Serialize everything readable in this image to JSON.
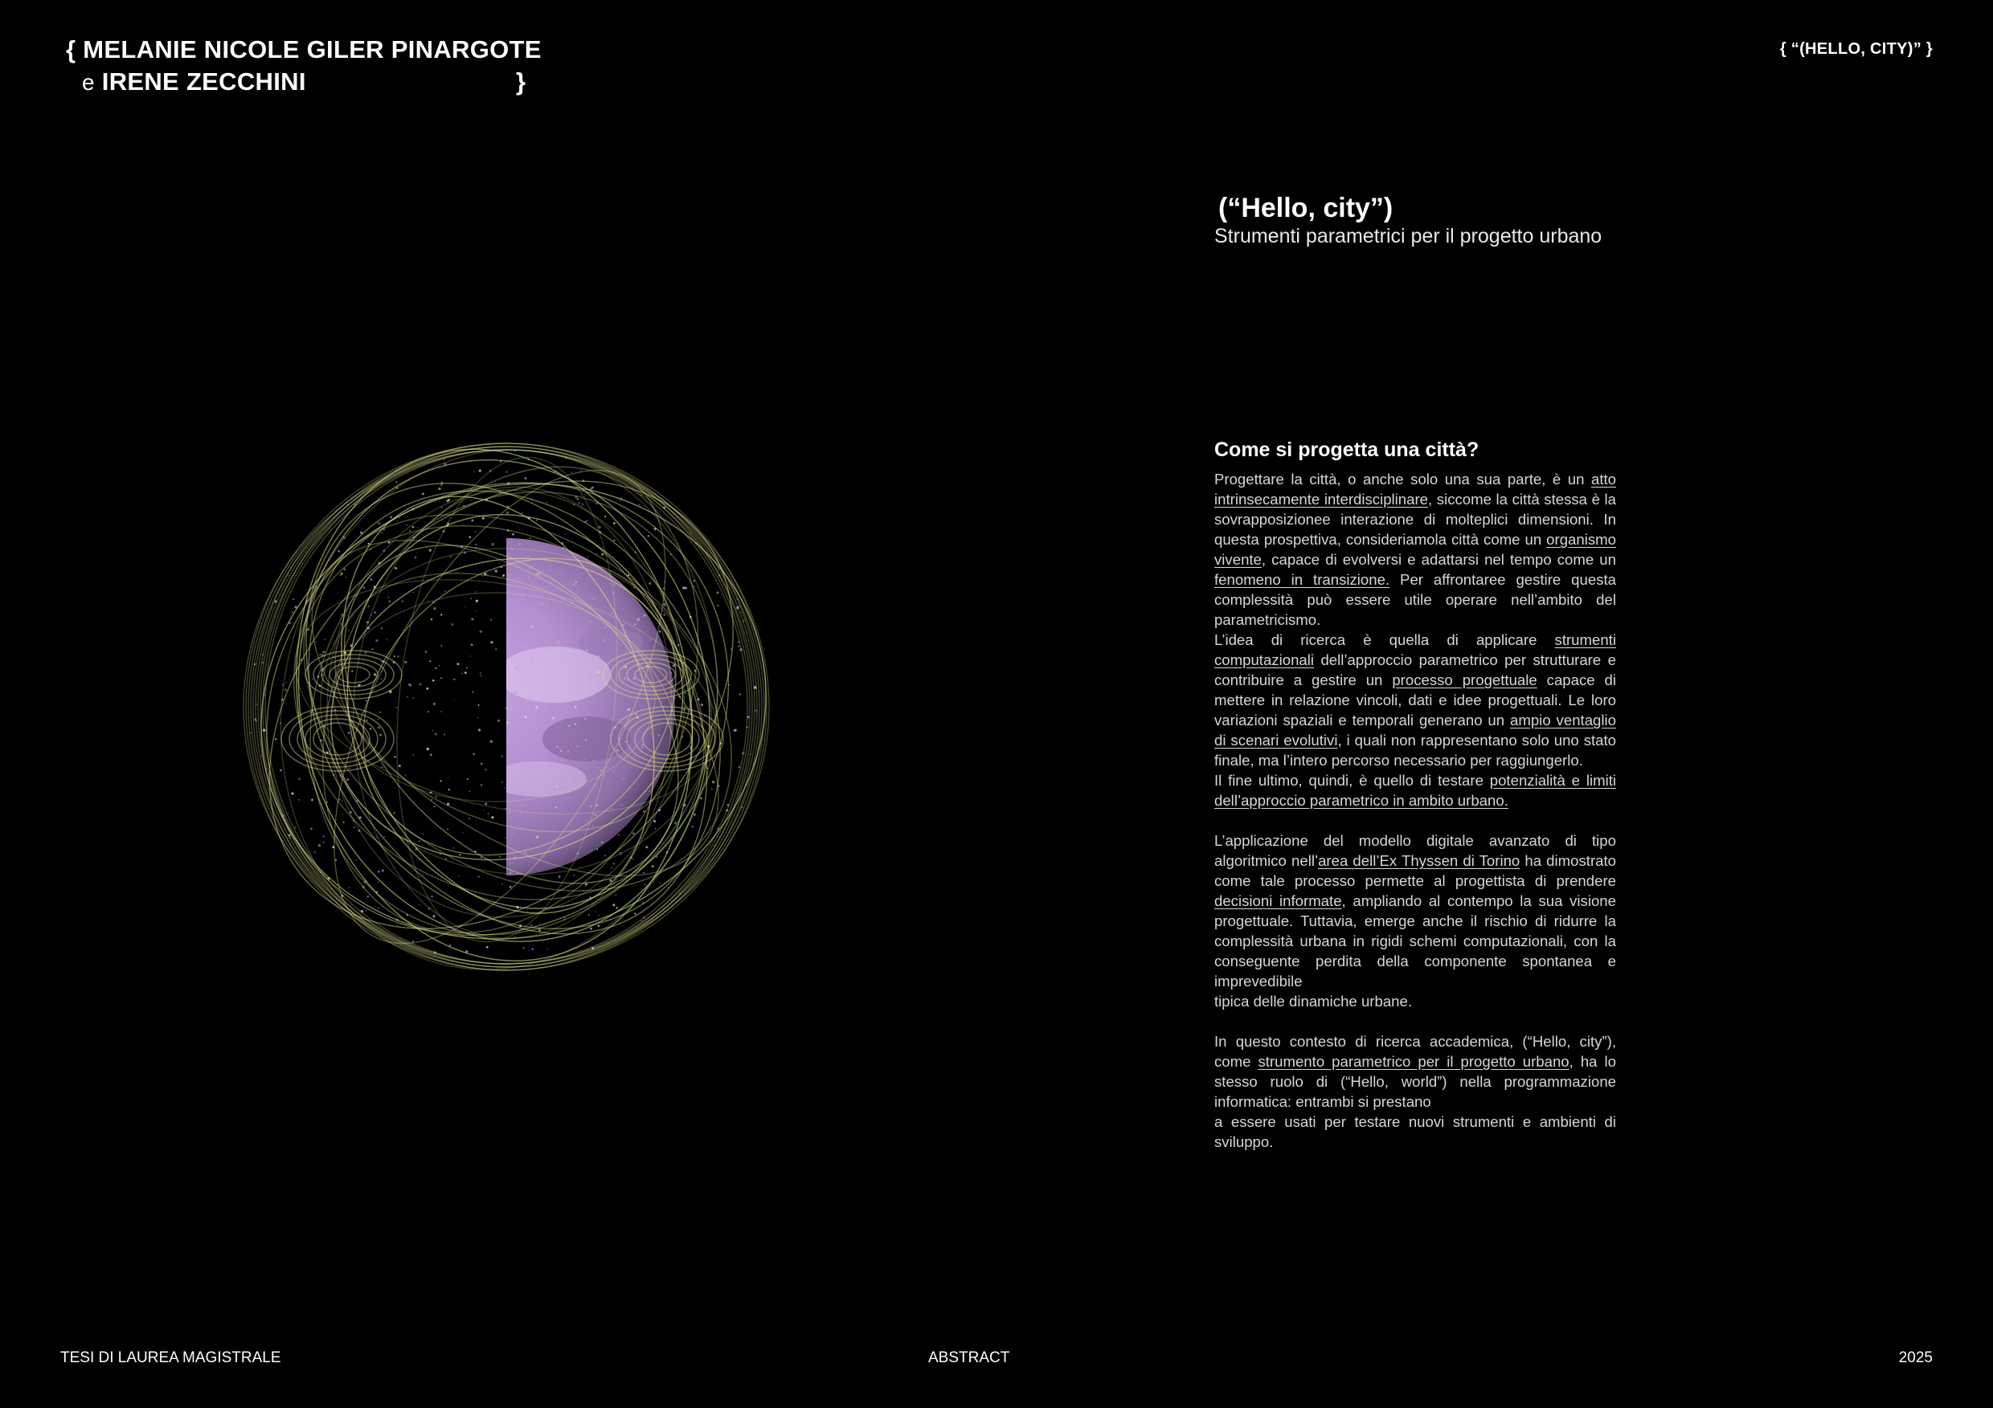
{
  "header": {
    "brace_open": "{",
    "author_1": "MELANIE NICOLE GILER PINARGOTE",
    "conj": "e",
    "author_2": "IRENE ZECCHINI",
    "brace_close": "}",
    "project_tag": "{  “(HELLO, CITY)”  }"
  },
  "title": "(“Hello, city”)",
  "subtitle": "Strumenti parametrici per il progetto urbano",
  "question": "Come si progetta una città?",
  "paragraphs": [
    [
      "Progettare la città, o anche solo una sua parte, è un ",
      {
        "u": "atto intrinsecamente interdisciplinare"
      },
      ", siccome la città stessa è la sovrapposizionee interazione di molteplici dimensioni. In questa prospettiva, consideriamola città come un ",
      {
        "u": "organismo vivente"
      },
      ", capace di evolversi e adattarsi nel tempo come un ",
      {
        "u": "fenomeno in transizione."
      },
      " Per affrontaree gestire questa complessità può essere utile operare nell’ambito del parametricismo."
    ],
    [
      "L’idea di ricerca è quella di applicare ",
      {
        "u": "strumenti computazionali"
      },
      " dell’approccio parametrico per strutturare e contribuire a gestire un ",
      {
        "u": "processo progettuale"
      },
      " capace di mettere in relazione vincoli, dati e idee progettuali. Le loro variazioni spaziali e temporali generano un ",
      {
        "u": "ampio ventaglio di scenari evolutivi"
      },
      ", i quali non rappresentano solo uno stato finale, ma l’intero percorso necessario per raggiungerlo."
    ],
    [
      "Il fine ultimo, quindi, è quello di testare ",
      {
        "u": "potenzialità e limiti dell’approccio parametrico in ambito urbano."
      }
    ],
    [],
    [
      "L’applicazione del modello digitale avanzato di tipo algoritmico nell’",
      {
        "u": "area dell’Ex Thyssen di Torino"
      },
      " ha dimostrato come tale processo permette al progettista di prendere ",
      {
        "u": "decisioni informate"
      },
      ", ampliando al contempo la sua visione progettuale. Tuttavia, emerge anche il rischio di ridurre la complessità urbana in rigidi schemi computazionali, con la conseguente perdita della componente spontanea e imprevedibile"
    ],
    [
      "tipica delle dinamiche urbane."
    ],
    [],
    [
      "In questo contesto di ricerca accademica, (“Hello, city”), come ",
      {
        "u": "strumento parametrico per il progetto urbano"
      },
      ", ha lo stesso ruolo di (“Hello, world”) nella programmazione informatica: entrambi si prestano"
    ],
    [
      "a essere usati per testare nuovi strumenti e ambienti di sviluppo."
    ]
  ],
  "footer": {
    "left": "TESI DI LAUREA MAGISTRALE",
    "center": "ABSTRACT",
    "right": "2025"
  },
  "colors": {
    "background": "#000000",
    "flow_lines": "#d8dc8a",
    "planet": "#b48fd0"
  }
}
